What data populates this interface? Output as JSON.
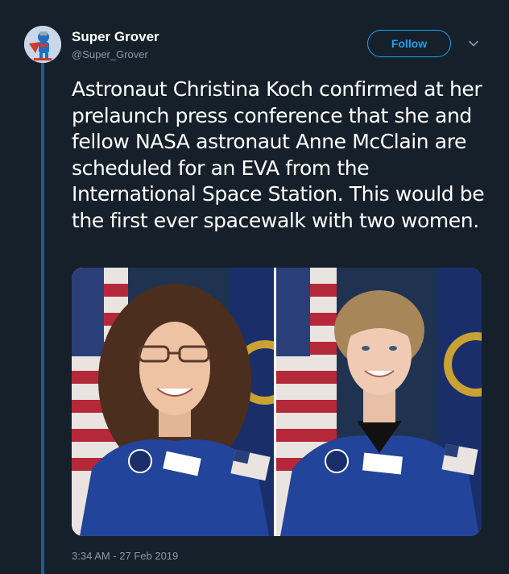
{
  "user": {
    "display_name": "Super Grover",
    "handle": "@Super_Grover",
    "avatar_icon": "super-grover-avatar"
  },
  "actions": {
    "follow_label": "Follow",
    "menu_icon": "chevron-down-icon"
  },
  "tweet": {
    "text": "Astronaut Christina Koch confirmed at her prelaunch press conference that she and fellow NASA astronaut Anne McClain are scheduled for an EVA from the International Space Station. This would be the first ever spacewalk with two women.",
    "timestamp": "3:34 AM - 27 Feb 2019"
  },
  "media": {
    "photos": [
      {
        "subject": "astronaut-portrait-long-curly-hair-glasses"
      },
      {
        "subject": "astronaut-portrait-short-blonde-hair"
      }
    ]
  },
  "colors": {
    "background": "#15202b",
    "accent": "#1da1f2",
    "secondary_text": "#8899a6",
    "thread_line": "#1f5d8c"
  }
}
